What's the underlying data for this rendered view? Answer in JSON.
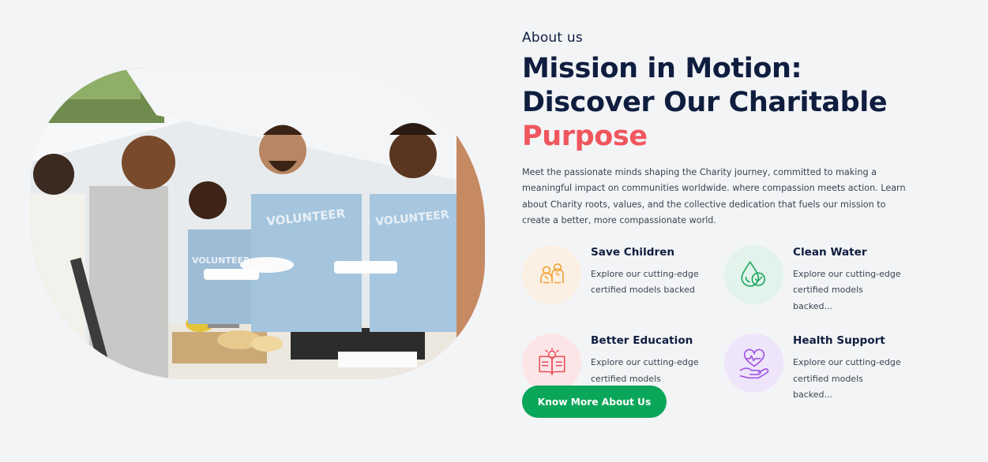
{
  "about": {
    "eyebrow": "About us",
    "headline_part1": "Mission in Motion: Discover Our Charitable ",
    "headline_accent": "Purpose",
    "description": "Meet the passionate minds shaping the Charity journey, committed to making a meaningful impact on communities worldwide. where compassion meets action. Learn about Charity roots, values, and the collective dedication that fuels our mission to create a better, more compassionate world."
  },
  "photo": {
    "shirt_text_1": "VOLUNTEER",
    "shirt_text_2": "VOLUNTEER",
    "shirt_text_3": "VOLUNTEER"
  },
  "features": [
    {
      "icon": "children-icon",
      "title": "Save Children",
      "text": "Explore our cutting-edge certified models backed"
    },
    {
      "icon": "water-drop-icon",
      "title": "Clean Water",
      "text": "Explore our cutting-edge certified models backed..."
    },
    {
      "icon": "education-book-icon",
      "title": "Better Education",
      "text": "Explore our cutting-edge certified models backed..."
    },
    {
      "icon": "health-heart-hand-icon",
      "title": "Health Support",
      "text": "Explore our cutting-edge certified models backed..."
    }
  ],
  "cta": {
    "label": "Know More About Us"
  },
  "colors": {
    "accent": "#f0565d",
    "primary": "#0aa65a",
    "heading": "#0f1e3f"
  }
}
